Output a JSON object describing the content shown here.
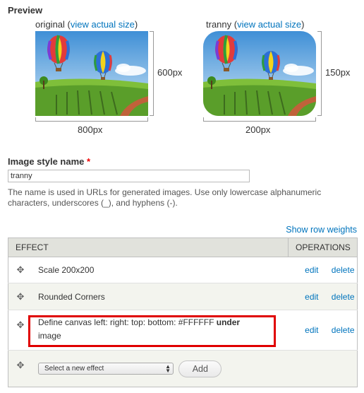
{
  "preview": {
    "title": "Preview",
    "original": {
      "label_prefix": "original (",
      "link": "view actual size",
      "label_suffix": ")",
      "width_label": "800px",
      "height_label": "600px"
    },
    "styled": {
      "label_prefix": "tranny (",
      "link": "view actual size",
      "label_suffix": ")",
      "width_label": "200px",
      "height_label": "150px"
    }
  },
  "name_field": {
    "label": "Image style name",
    "required_mark": "*",
    "value": "tranny",
    "description": "The name is used in URLs for generated images. Use only lowercase alphanumeric characters, underscores (_), and hyphens (-)."
  },
  "table": {
    "show_row_weights": "Show row weights",
    "headers": {
      "effect": "EFFECT",
      "operations": "OPERATIONS"
    },
    "rows": [
      {
        "effect": "Scale 200x200",
        "edit": "edit",
        "delete": "delete"
      },
      {
        "effect": "Rounded Corners",
        "edit": "edit",
        "delete": "delete"
      },
      {
        "effect_text": "Define canvas left: right: top: bottom:  #FFFFFF ",
        "effect_bold": "under",
        "effect_tail": "image",
        "edit": "edit",
        "delete": "delete"
      }
    ],
    "new_effect": {
      "select_value": "Select a new effect",
      "add_label": "Add"
    }
  },
  "colors": {
    "link": "#0074bd",
    "highlight": "#e00000",
    "header_bg": "#e1e2dc"
  },
  "icons": {
    "drag": "move-cross-icon",
    "select": "chevron-updown-icon"
  }
}
